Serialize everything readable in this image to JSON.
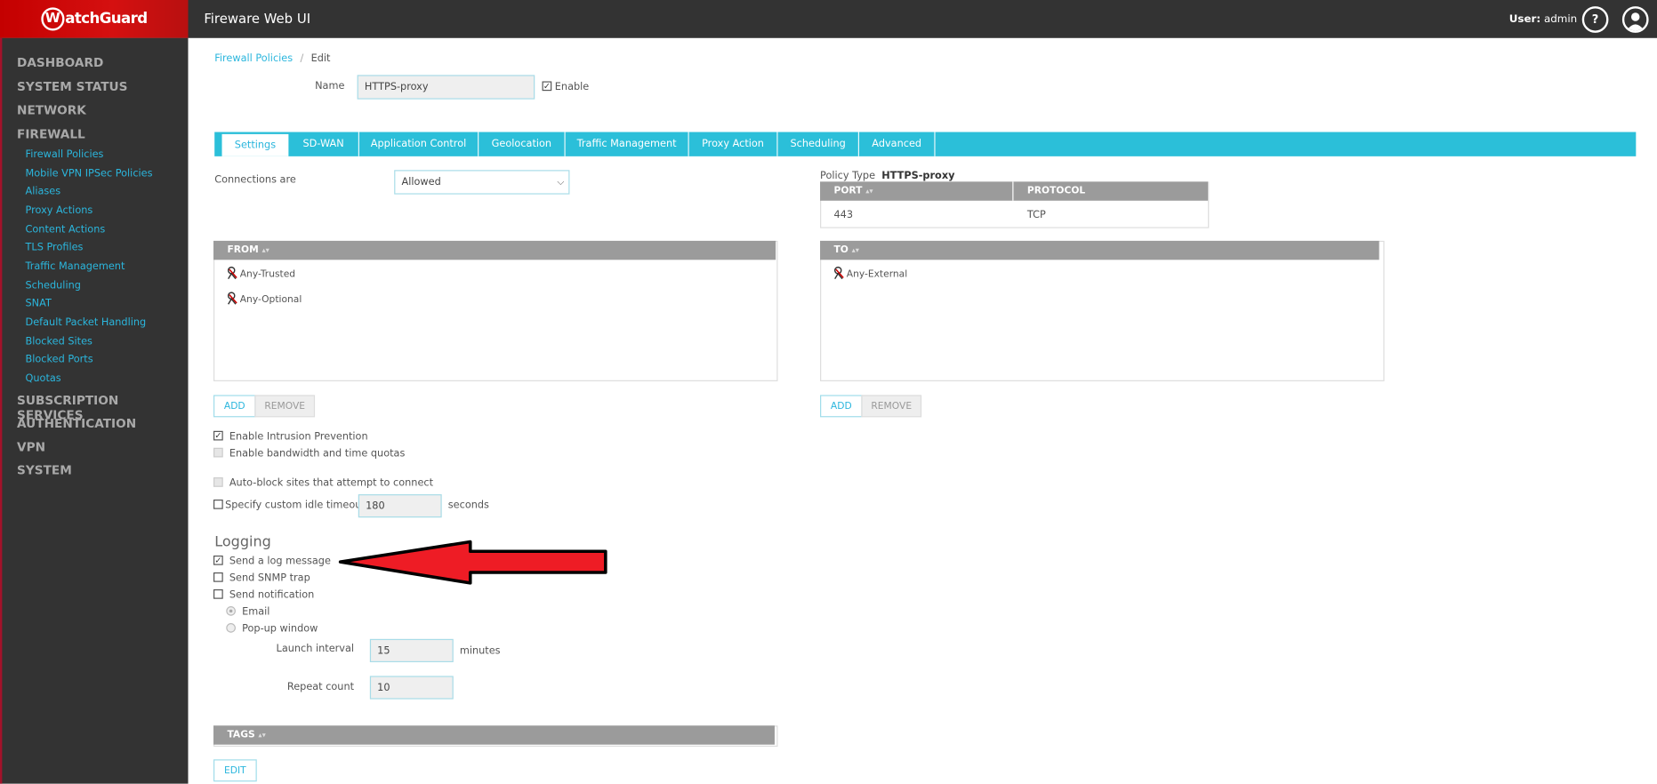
{
  "header": {
    "logo": "WatchGuard",
    "app_title": "Fireware Web UI",
    "user_label": "User:",
    "user_name": "admin",
    "help_icon": "question-circle-icon",
    "user_icon": "user-avatar-icon"
  },
  "sidebar": {
    "sections_top": [
      "DASHBOARD",
      "SYSTEM STATUS",
      "NETWORK",
      "FIREWALL"
    ],
    "firewall_items": [
      "Firewall Policies",
      "Mobile VPN IPSec Policies",
      "Aliases",
      "Proxy Actions",
      "Content Actions",
      "TLS Profiles",
      "Traffic Management",
      "Scheduling",
      "SNAT",
      "Default Packet Handling",
      "Blocked Sites",
      "Blocked Ports",
      "Quotas"
    ],
    "sections_bottom": [
      "SUBSCRIPTION SERVICES",
      "AUTHENTICATION",
      "VPN",
      "SYSTEM"
    ]
  },
  "breadcrumb": {
    "link": "Firewall Policies",
    "sep": "/",
    "current": "Edit"
  },
  "name_field": {
    "label": "Name",
    "value": "HTTPS-proxy",
    "enable_label": "Enable",
    "enabled": true
  },
  "tabs": [
    {
      "label": "Settings",
      "active": true
    },
    {
      "label": "SD-WAN"
    },
    {
      "label": "Application Control"
    },
    {
      "label": "Geolocation"
    },
    {
      "label": "Traffic Management"
    },
    {
      "label": "Proxy Action"
    },
    {
      "label": "Scheduling"
    },
    {
      "label": "Advanced"
    }
  ],
  "settings": {
    "connections_label": "Connections are",
    "connections_value": "Allowed",
    "policy_type_label": "Policy Type",
    "policy_type_value": "HTTPS-proxy",
    "ports": {
      "headers": [
        "PORT",
        "PROTOCOL"
      ],
      "rows": [
        [
          "443",
          "TCP"
        ]
      ]
    },
    "from": {
      "header": "FROM",
      "items": [
        "Any-Trusted",
        "Any-Optional"
      ]
    },
    "to": {
      "header": "TO",
      "items": [
        "Any-External"
      ]
    },
    "add_label": "ADD",
    "remove_label": "REMOVE",
    "options": [
      {
        "label": "Enable Intrusion Prevention",
        "checked": true
      },
      {
        "label": "Enable bandwidth and time quotas",
        "checked": false,
        "disabled": true
      },
      {
        "label": "Auto-block sites that attempt to connect",
        "checked": false,
        "disabled": true
      },
      {
        "label": "Specify custom idle timeout",
        "checked": false
      }
    ],
    "idle_timeout": "180",
    "idle_unit": "seconds"
  },
  "logging": {
    "title": "Logging",
    "options": [
      {
        "label": "Send a log message",
        "checked": true
      },
      {
        "label": "Send SNMP trap",
        "checked": false
      },
      {
        "label": "Send notification",
        "checked": false
      }
    ],
    "radios": [
      {
        "label": "Email",
        "selected": true
      },
      {
        "label": "Pop-up window",
        "selected": false
      }
    ],
    "launch_label": "Launch interval",
    "launch_value": "15",
    "launch_unit": "minutes",
    "repeat_label": "Repeat count",
    "repeat_value": "10"
  },
  "tags": {
    "header": "TAGS",
    "edit_label": "EDIT"
  },
  "colors": {
    "accent": "#2bbfd9",
    "brand_red": "#c40000",
    "sidebar_bg": "#333333",
    "annotation_arrow": "#ee1c25"
  }
}
